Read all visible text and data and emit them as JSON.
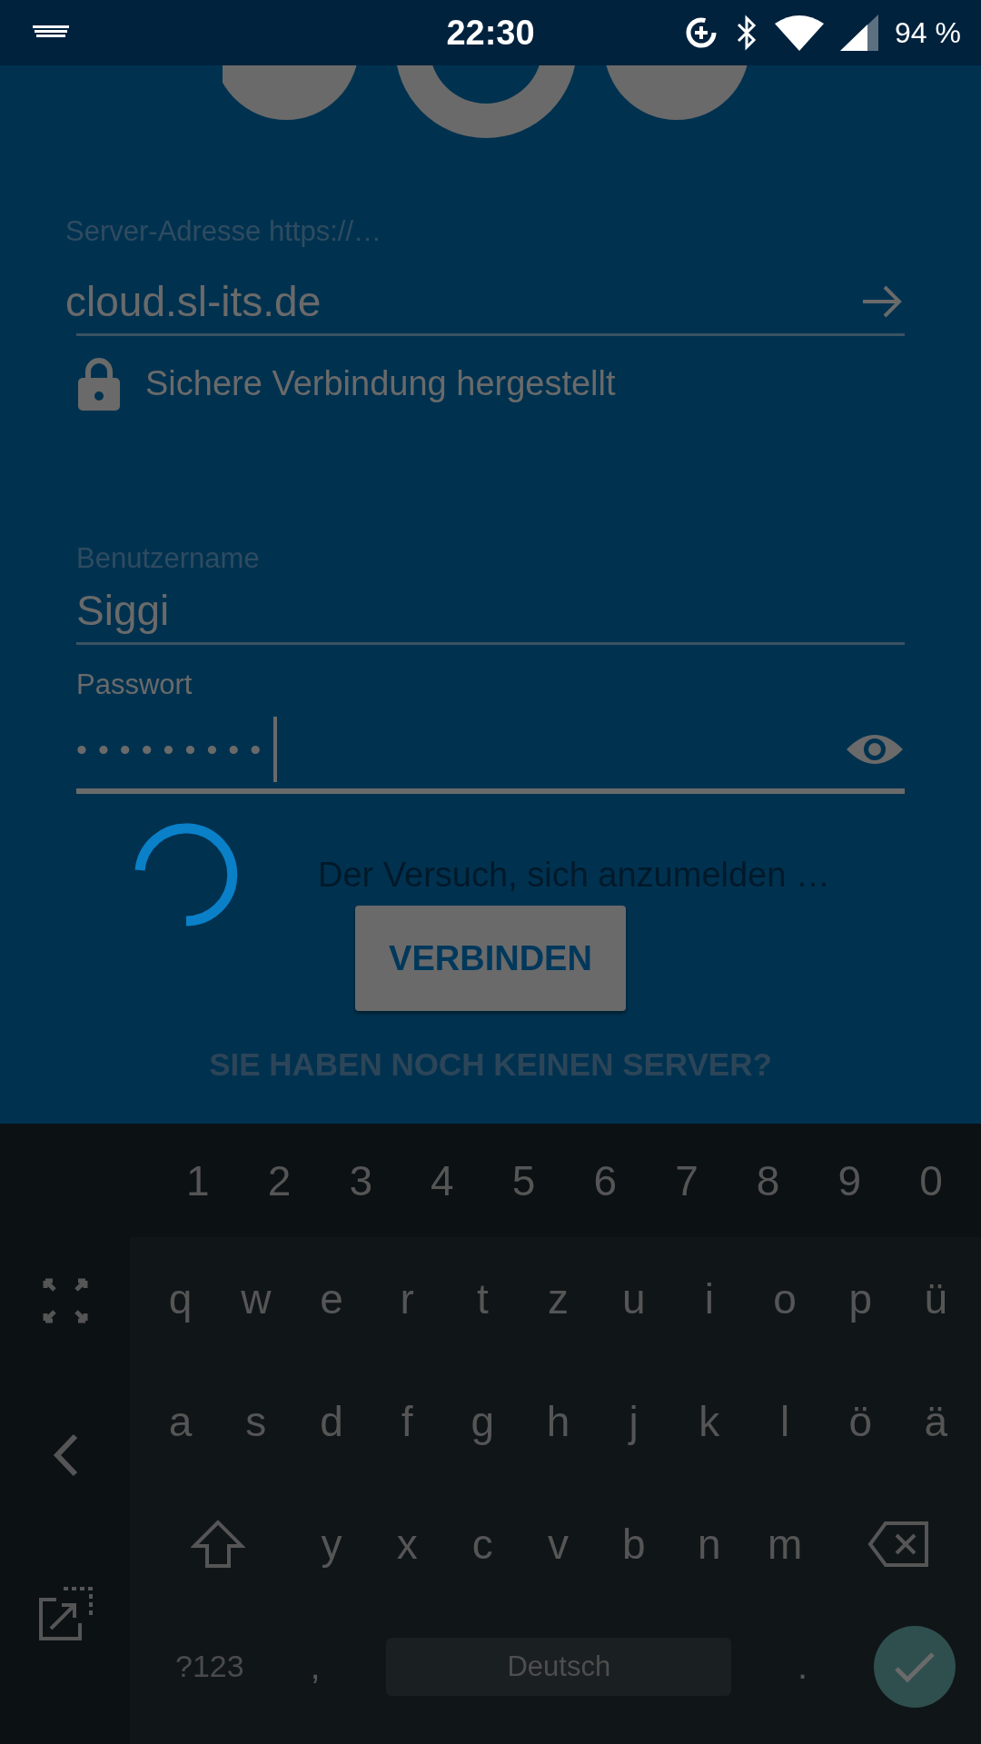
{
  "status_bar": {
    "time": "22:30",
    "battery": "94 %"
  },
  "server": {
    "label": "Server-Adresse https://…",
    "value": "cloud.sl-its.de"
  },
  "security": {
    "text": "Sichere Verbindung hergestellt"
  },
  "username": {
    "label": "Benutzername",
    "value": "Siggi"
  },
  "password": {
    "label": "Passwort",
    "value": "•••••••••"
  },
  "loading": {
    "message": "Der Versuch, sich anzumelden …"
  },
  "connect_button": "VERBINDEN",
  "no_server_link": "SIE HABEN NOCH KEINEN SERVER?",
  "keyboard": {
    "number_row": [
      "1",
      "2",
      "3",
      "4",
      "5",
      "6",
      "7",
      "8",
      "9",
      "0"
    ],
    "rows": [
      [
        "q",
        "w",
        "e",
        "r",
        "t",
        "z",
        "u",
        "i",
        "o",
        "p",
        "ü"
      ],
      [
        "a",
        "s",
        "d",
        "f",
        "g",
        "h",
        "j",
        "k",
        "l",
        "ö",
        "ä"
      ],
      [
        "",
        "",
        "y",
        "x",
        "c",
        "v",
        "b",
        "n",
        "m"
      ]
    ],
    "symbols_key": "?123",
    "comma": ",",
    "space_label": "Deutsch",
    "period": "."
  }
}
